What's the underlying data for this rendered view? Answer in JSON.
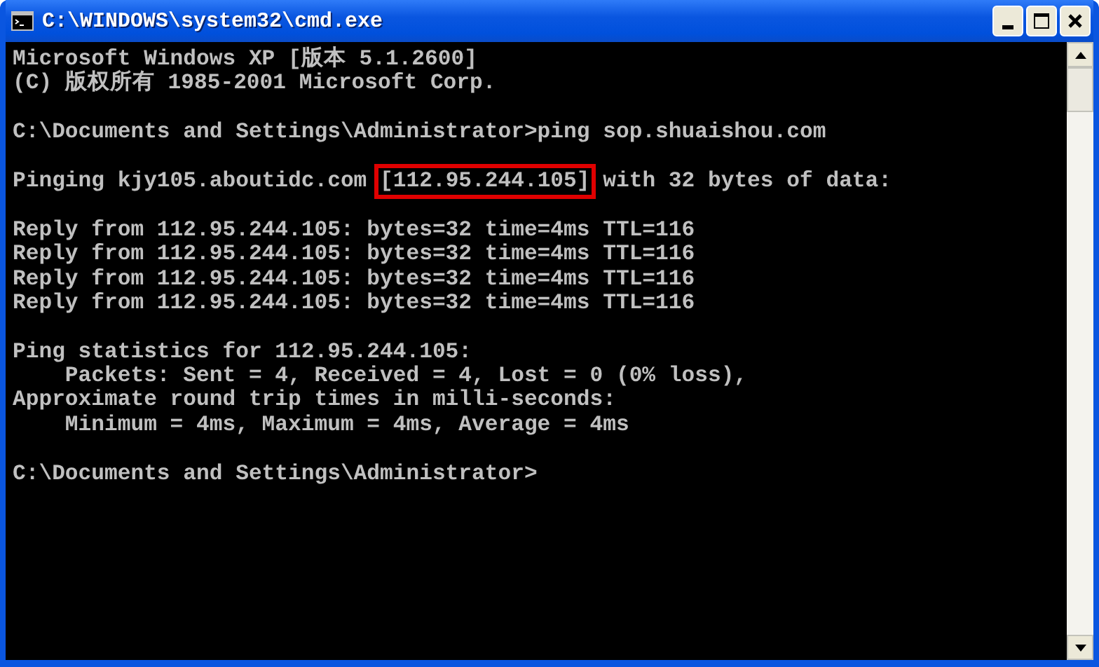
{
  "window": {
    "title": "C:\\WINDOWS\\system32\\cmd.exe"
  },
  "console": {
    "lines": [
      {
        "kind": "text",
        "text": "Microsoft Windows XP [版本 5.1.2600]"
      },
      {
        "kind": "text",
        "text": "(C) 版权所有 1985-2001 Microsoft Corp."
      },
      {
        "kind": "blank"
      },
      {
        "kind": "text",
        "text": "C:\\Documents and Settings\\Administrator>ping sop.shuaishou.com"
      },
      {
        "kind": "blank"
      },
      {
        "kind": "segments",
        "segments": [
          {
            "text": "Pinging kjy105.aboutidc.com ",
            "highlighted": false
          },
          {
            "text": "[112.95.244.105]",
            "highlighted": true
          },
          {
            "text": " with 32 bytes of data:",
            "highlighted": false
          }
        ]
      },
      {
        "kind": "blank"
      },
      {
        "kind": "text",
        "text": "Reply from 112.95.244.105: bytes=32 time=4ms TTL=116"
      },
      {
        "kind": "text",
        "text": "Reply from 112.95.244.105: bytes=32 time=4ms TTL=116"
      },
      {
        "kind": "text",
        "text": "Reply from 112.95.244.105: bytes=32 time=4ms TTL=116"
      },
      {
        "kind": "text",
        "text": "Reply from 112.95.244.105: bytes=32 time=4ms TTL=116"
      },
      {
        "kind": "blank"
      },
      {
        "kind": "text",
        "text": "Ping statistics for 112.95.244.105:"
      },
      {
        "kind": "text",
        "text": "    Packets: Sent = 4, Received = 4, Lost = 0 (0% loss),"
      },
      {
        "kind": "text",
        "text": "Approximate round trip times in milli-seconds:"
      },
      {
        "kind": "text",
        "text": "    Minimum = 4ms, Maximum = 4ms, Average = 4ms"
      },
      {
        "kind": "blank"
      },
      {
        "kind": "text",
        "text": "C:\\Documents and Settings\\Administrator>"
      }
    ]
  }
}
